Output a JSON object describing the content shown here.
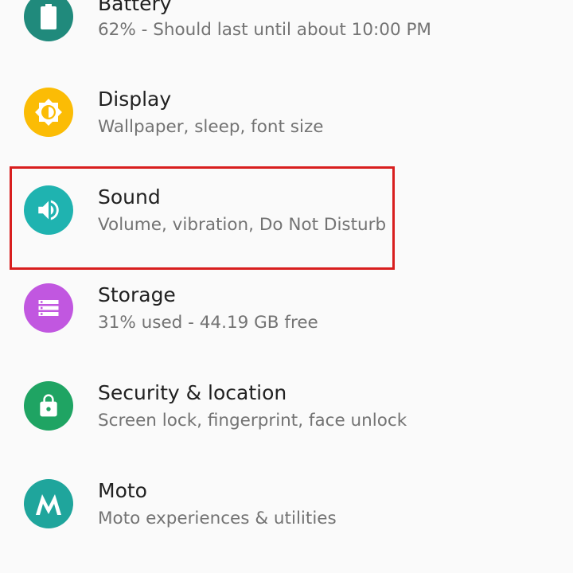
{
  "settings": {
    "items": [
      {
        "id": "battery",
        "title": "Battery",
        "subtitle": "62% - Should last until about 10:00 PM",
        "icon": "battery-icon",
        "color": "#208a7c"
      },
      {
        "id": "display",
        "title": "Display",
        "subtitle": "Wallpaper, sleep, font size",
        "icon": "brightness-icon",
        "color": "#fbbc05"
      },
      {
        "id": "sound",
        "title": "Sound",
        "subtitle": "Volume, vibration, Do Not Disturb",
        "icon": "volume-icon",
        "color": "#1fb3b0"
      },
      {
        "id": "storage",
        "title": "Storage",
        "subtitle": "31% used - 44.19 GB free",
        "icon": "storage-icon",
        "color": "#c157e0"
      },
      {
        "id": "security",
        "title": "Security & location",
        "subtitle": "Screen lock, fingerprint, face unlock",
        "icon": "lock-icon",
        "color": "#1fa463"
      },
      {
        "id": "moto",
        "title": "Moto",
        "subtitle": "Moto experiences & utilities",
        "icon": "moto-logo-icon",
        "color": "#1fa59c"
      }
    ],
    "highlighted": "sound",
    "highlight_color": "#d81e1e"
  }
}
